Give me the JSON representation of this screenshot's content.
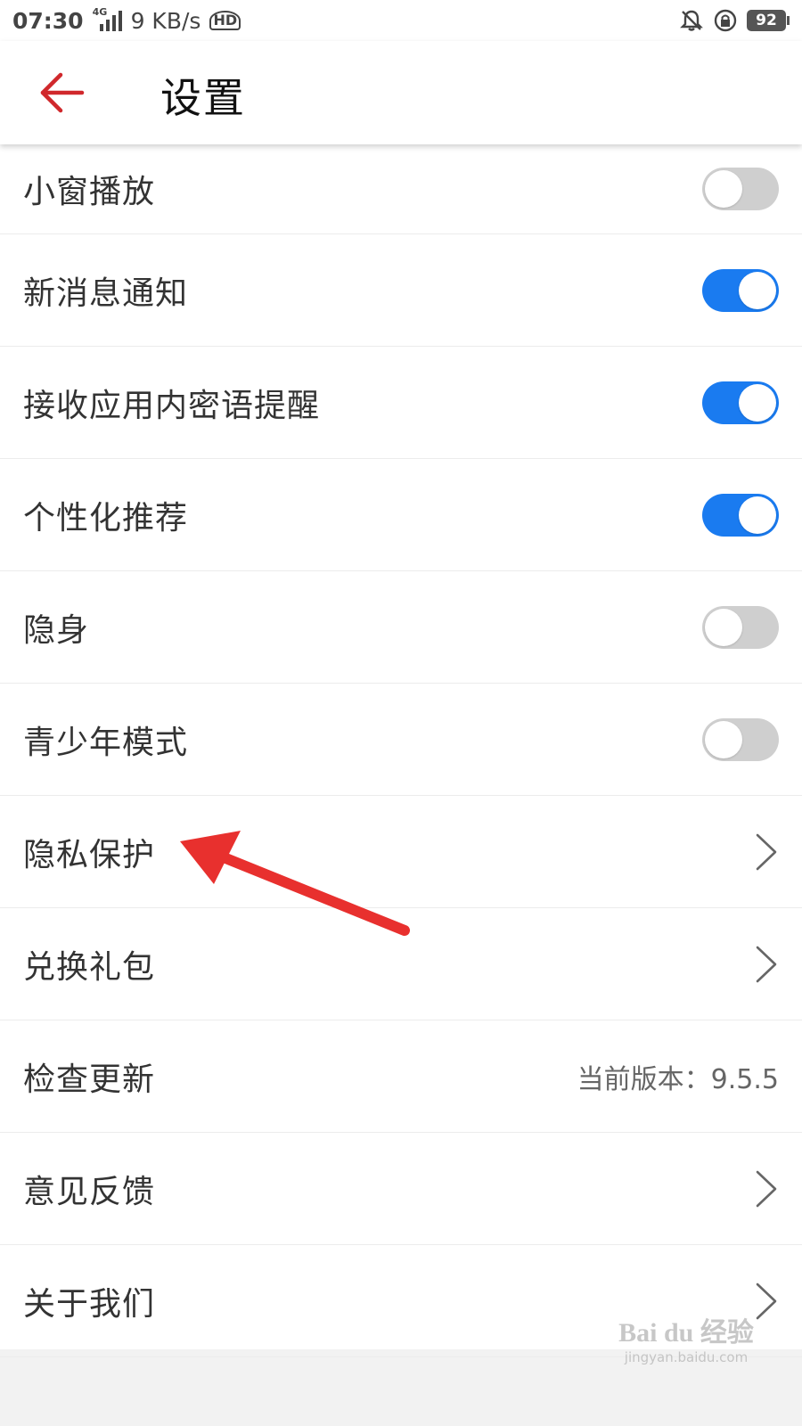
{
  "status_bar": {
    "time": "07:30",
    "network": "4G",
    "speed": "9 KB/s",
    "hd": "HD",
    "battery": "92"
  },
  "header": {
    "title": "设置"
  },
  "settings": [
    {
      "label": "小窗播放",
      "control": "toggle",
      "state": "off"
    },
    {
      "label": "新消息通知",
      "control": "toggle",
      "state": "on"
    },
    {
      "label": "接收应用内密语提醒",
      "control": "toggle",
      "state": "on"
    },
    {
      "label": "个性化推荐",
      "control": "toggle",
      "state": "on"
    },
    {
      "label": "隐身",
      "control": "toggle",
      "state": "off"
    },
    {
      "label": "青少年模式",
      "control": "toggle",
      "state": "off"
    },
    {
      "label": "隐私保护",
      "control": "chevron"
    },
    {
      "label": "兑换礼包",
      "control": "chevron"
    },
    {
      "label": "检查更新",
      "control": "text",
      "value": "当前版本：9.5.5"
    },
    {
      "label": "意见反馈",
      "control": "chevron"
    },
    {
      "label": "关于我们",
      "control": "chevron"
    }
  ],
  "colors": {
    "toggle_on": "#1a7bf0",
    "toggle_off": "#cfcfcf",
    "back_arrow": "#d0282c",
    "annotation_arrow": "#e8302e"
  },
  "watermark": {
    "brand": "Bai du 经验",
    "url": "jingyan.baidu.com"
  }
}
